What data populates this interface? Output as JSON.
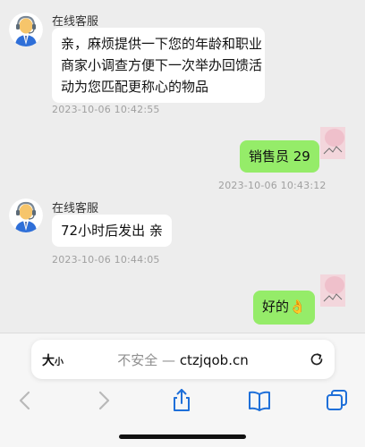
{
  "chat": {
    "messages": [
      {
        "sender": "在线客服",
        "lines": [
          "亲，麻烦提供一下您的年龄和职业",
          "商家小调查方便下一次举办回馈活",
          "动为您匹配更称心的物品"
        ],
        "time": "2023-10-06 10:42:55"
      },
      {
        "text": "销售员 29",
        "time": "2023-10-06 10:43:12"
      },
      {
        "sender": "在线客服",
        "text": "72小时后发出 亲",
        "time": "2023-10-06 10:44:05"
      },
      {
        "text": "好的👌"
      }
    ]
  },
  "browser": {
    "text_size_big": "大",
    "text_size_small": "小",
    "insecure_label": "不安全 —",
    "domain": "ctzjqob.cn",
    "icons": {
      "reload": "reload-icon",
      "back": "back-icon",
      "forward": "forward-icon",
      "share": "share-icon",
      "bookmarks": "bookmarks-icon",
      "tabs": "tabs-icon"
    }
  },
  "colors": {
    "background": "#ededed",
    "incoming_bubble": "#ffffff",
    "outgoing_bubble": "#95ec69",
    "timestamp": "#a0a0a0",
    "accent_blue": "#1e6fd9"
  }
}
